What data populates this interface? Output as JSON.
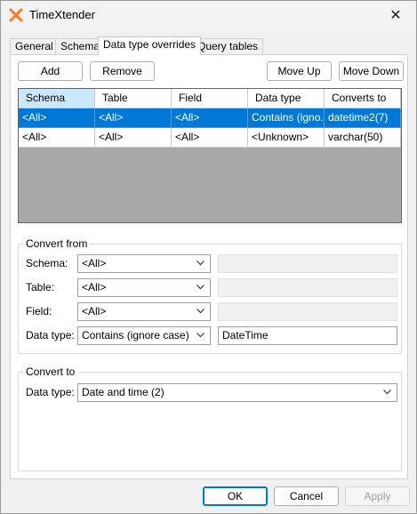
{
  "window": {
    "title": "TimeXtender",
    "close_glyph": "✕",
    "app_icon": "timextender-logo-icon",
    "accent": "#ff7a1a"
  },
  "tabs": [
    {
      "label": "General"
    },
    {
      "label": "Schema"
    },
    {
      "label": "Data type overrides",
      "active": true
    },
    {
      "label": "Query tables"
    }
  ],
  "toolbar": {
    "add": "Add",
    "remove": "Remove",
    "move_up": "Move Up",
    "move_down": "Move Down"
  },
  "grid": {
    "columns": [
      "Schema",
      "Table",
      "Field",
      "Data type",
      "Converts to"
    ],
    "rows": [
      {
        "cells": [
          "<All>",
          "<All>",
          "<All>",
          "Contains (igno...",
          "datetime2(7)"
        ],
        "selected": true
      },
      {
        "cells": [
          "<All>",
          "<All>",
          "<All>",
          "<Unknown>",
          "varchar(50)"
        ],
        "selected": false
      }
    ],
    "selection_color": "#0078d7"
  },
  "convert_from": {
    "title": "Convert from",
    "schema": {
      "label": "Schema:",
      "value": "<All>",
      "text": ""
    },
    "table": {
      "label": "Table:",
      "value": "<All>",
      "text": ""
    },
    "field": {
      "label": "Field:",
      "value": "<All>",
      "text": ""
    },
    "data_type": {
      "label": "Data type:",
      "value": "Contains (ignore case)",
      "text": "DateTime"
    }
  },
  "convert_to": {
    "title": "Convert to",
    "data_type": {
      "label": "Data type:",
      "value": "Date and time (2)"
    }
  },
  "footer": {
    "ok": "OK",
    "cancel": "Cancel",
    "apply": "Apply"
  }
}
